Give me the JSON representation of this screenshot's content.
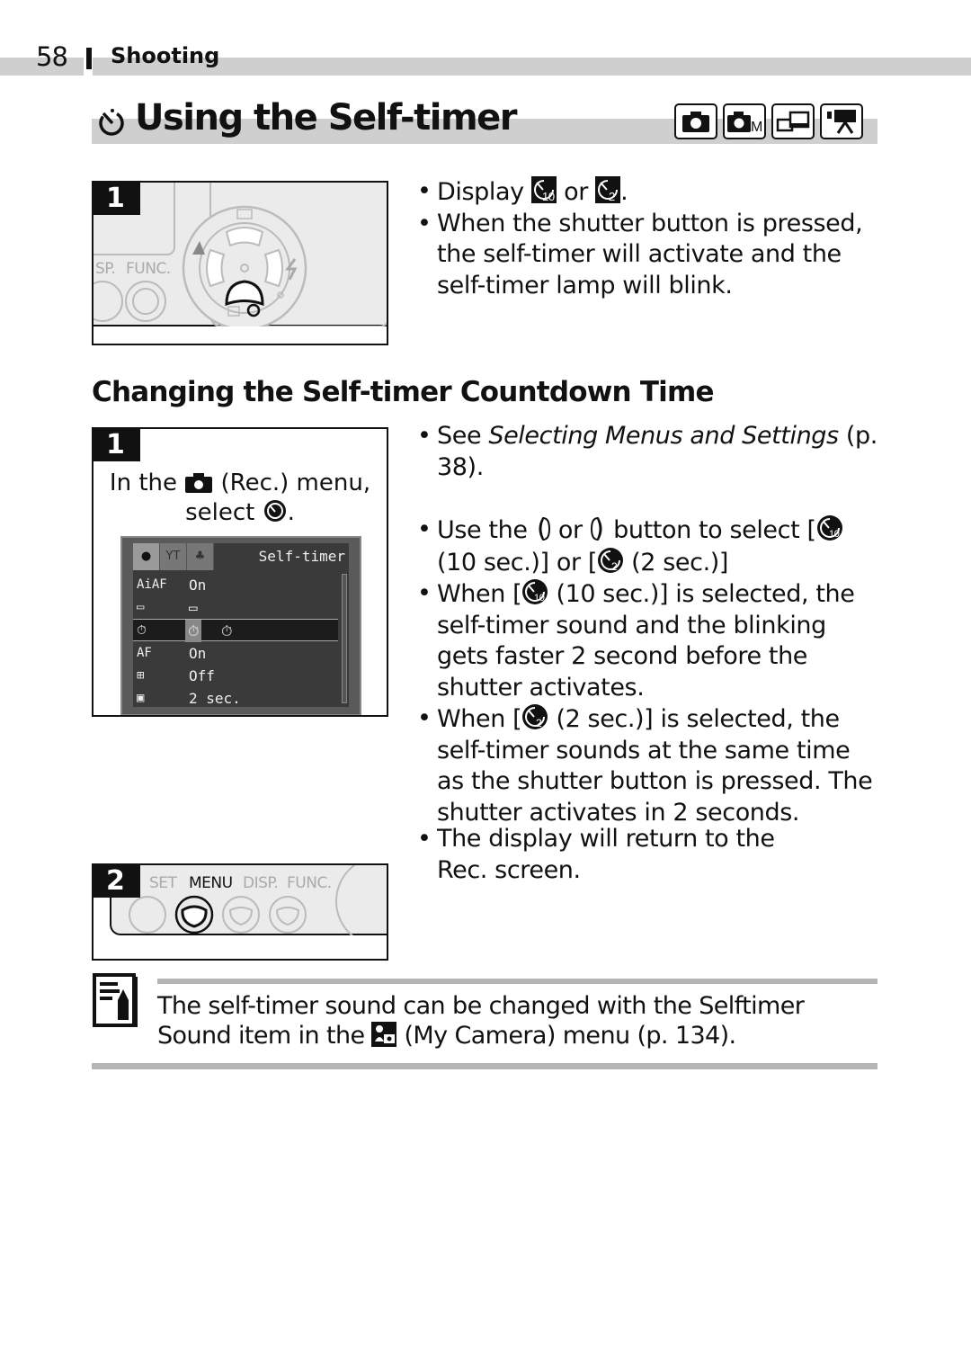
{
  "header": {
    "page_number": "58",
    "section": "Shooting"
  },
  "title": {
    "icon": "self-timer-icon",
    "text": "Using the Self-timer",
    "mode_icons": [
      "camera-auto-icon",
      "camera-manual-icon",
      "stitch-assist-icon",
      "movie-icon"
    ],
    "mode_manual_letter": "M"
  },
  "section1": {
    "step_number": "1",
    "illustration": {
      "labels": [
        "SP.",
        "FUNC."
      ],
      "highlighted_button": "down-button (self-timer / drive mode)"
    },
    "bullets": {
      "b1_prefix": "Display",
      "b1_mid": "or",
      "b1_suffix": ".",
      "b1_icons": [
        "self-timer-10s-icon",
        "self-timer-2s-icon"
      ],
      "b2": "When the shutter button is pressed, the self-timer will activate and the self-timer lamp will blink."
    }
  },
  "section2": {
    "heading": "Changing the Self-timer Countdown Time",
    "step1": {
      "number": "1",
      "caption_a": "In the",
      "caption_b": "(Rec.) menu,",
      "caption_c": "select",
      "caption_d": ".",
      "menu_screen": {
        "title": "Self-timer",
        "tabs": [
          "rec-tab",
          "setup-tab",
          "my-camera-tab"
        ],
        "rows": [
          {
            "icon": "AiAF",
            "value": "On"
          },
          {
            "icon": "review",
            "value": "review-icon"
          },
          {
            "icon": "self-timer",
            "value": "10s / 2s",
            "selected": true
          },
          {
            "icon": "AF-assist",
            "value": "On"
          },
          {
            "icon": "digital-zoom",
            "value": "Off"
          },
          {
            "icon": "review-time",
            "value": "2 sec."
          }
        ]
      }
    },
    "step2": {
      "number": "2",
      "labels": [
        "SET",
        "MENU",
        "DISP.",
        "FUNC."
      ]
    },
    "bullets": {
      "see_prefix": "See ",
      "see_italic": "Selecting Menus and Settings",
      "see_suffix": " (p. 38).",
      "use_a": "Use the",
      "use_b": "or",
      "use_c": "button to select [",
      "use_d": "(10 sec.)] or [",
      "use_e": "(2 sec.)]",
      "when10_a": "When [",
      "when10_b": "(10 sec.)] is selected, the self-timer sound and the blinking gets faster 2 second before the shutter activates.",
      "when2_a": "When [",
      "when2_b": "(2 sec.)] is selected, the self-timer sounds at the same time as the shutter button is pressed. The shutter activates in 2 seconds.",
      "return": "The display will return to the Rec. screen."
    }
  },
  "note": {
    "icon": "memo-pencil-icon",
    "line1": "The self-timer sound can be changed with the Selftimer",
    "line2_a": "Sound item in the",
    "line2_b": "(My Camera) menu (p. 134)."
  }
}
